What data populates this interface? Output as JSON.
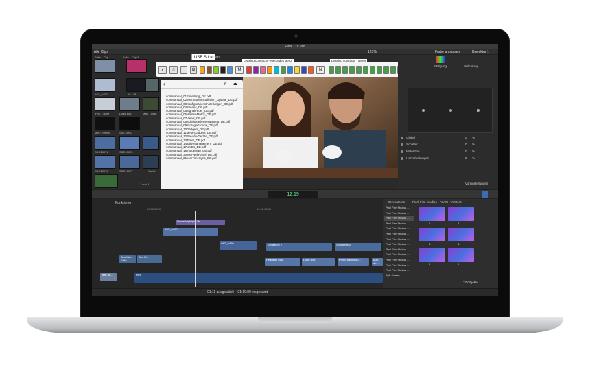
{
  "app": {
    "title": "Final Cut Pro"
  },
  "browser": {
    "header": "Alle Clips",
    "labels": [
      "Folie ...Clip 1",
      "Folie ...Clip 2",
      "IMG_0450",
      "IM...48",
      "IM...48",
      "iPho ...uuhe",
      "Logic Bild",
      "Mac ...desk",
      "MBP-Retina",
      "Sch...de 1",
      "Sch...de 2",
      "SDC15071",
      "SDC15074",
      "SDC15075",
      "SDC15076",
      "SDC15077",
      "Switch"
    ],
    "count": "1 von 8..."
  },
  "usb_stick": {
    "title": "USB Stick",
    "title_ghost": "...linen",
    "group_mb": "Leasing contracts - Mercedes Benz",
    "group_bmw": "Leasing contracts - BMW",
    "m_key": "M",
    "n_key": "N",
    "key_colors": [
      "#e53935",
      "#8e24aa",
      "#f06292",
      "#ff9800",
      "#00bcd4",
      "#43a047",
      "#1e88e5",
      "#fdd835",
      "#3949ab",
      "#ff5722"
    ]
  },
  "popup": {
    "files": [
      "vomManual_01Einleitung_DE.pdf",
      "vomManual_02vomStudioInstallation_Update_DE.pdf",
      "vomManual_03KonfigurationsInstellungen_DE.pdf",
      "vomManual_04Szenes_DE.pdf",
      "vomManual_05SignalFeuer_DE.pdf",
      "vomManual_06Master-Matrix_DE.pdf",
      "vomManual_07Views_DE.pdf",
      "vomManual_08Schnittstellenverwaltung_DE.pdf",
      "vomManual_09StorageGroups_DE.pdf",
      "vomManual_10Gadgets_DE.pdf",
      "vomManual_11Meta-Gadgets_DE.pdf",
      "vomManual_12Pseudo-Geräte_DE.pdf",
      "vomManual_13Timer_DE.pdf",
      "vomManual_14Tally-Management_DE.pdf",
      "vomManual_17UMDs_DE.pdf",
      "vomManual_18ImageMap_DE.pdf",
      "vomManual_20vomWebPanel_DE.pdf",
      "vomManual_21vomTimeSync_DE.pdf"
    ]
  },
  "viewer": {
    "zoom": "123%",
    "timecode": "12:19"
  },
  "inspector": {
    "title_left": "Farbe anpassen",
    "title_right": "Korrektur 1",
    "tab_saettigung": "Sättigung",
    "tab_belichtung": "Belichtung",
    "options": [
      "Global",
      "Schatten",
      "Mitteltöne",
      "Hervorhebungen"
    ],
    "unit": "%",
    "value": "0",
    "settings": "Voreinstellungen"
  },
  "timeline": {
    "header": "Funktionen",
    "ruler": [
      "00:00:00:00",
      "00:00:15:00"
    ],
    "clips": [
      "Drone Highlight 3b",
      "IMG_0450",
      "IMG_0496",
      "Schaltede 2",
      "Schaltede 2",
      "Headstar Mac",
      "Logic Bild",
      "Photo Backgrou...",
      "Mac de...",
      "Abo Mac Folie",
      "Abo M...",
      "Mac de...",
      "Intro"
    ]
  },
  "generators": {
    "header": "Generatoren",
    "title": "Pixel Film Studios - FLASH VOGUE",
    "items": [
      "Pixel Film Studios -...",
      "Pixel Film Studios -...",
      "Pixel Film Studios -...",
      "Pixel Film Studios -...",
      "Pixel Film Studios -...",
      "Pixel Film Studios -...",
      "Pixel Film Studios -...",
      "Pixel Film Studios -...",
      "Pixel Film Studios -...",
      "Pixel Film Studios -...",
      "Pixel Film Studios -...",
      "Pixel Film Studios -...",
      "Pixel Film Studios -...",
      "Split Screen"
    ],
    "thumb_labels": [
      "1.",
      "2.",
      "3.",
      "4.",
      "5.",
      "6."
    ],
    "count": "32 Objekte"
  },
  "status": {
    "text": "01:11 ausgewählt – 01:10:00 insgesamt"
  }
}
